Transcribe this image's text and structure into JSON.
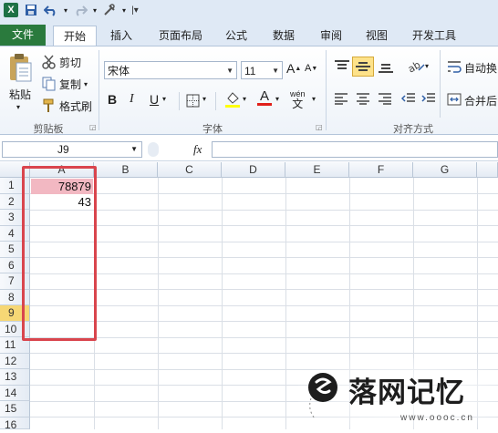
{
  "file_tab": "文件",
  "tabs": [
    "开始",
    "插入",
    "页面布局",
    "公式",
    "数据",
    "审阅",
    "视图",
    "开发工具"
  ],
  "clipboard": {
    "paste": "粘贴",
    "cut": "剪切",
    "copy": "复制",
    "format_painter": "格式刷",
    "group_label": "剪贴板"
  },
  "font": {
    "name": "宋体",
    "size": "11",
    "group_label": "字体",
    "bold": "B",
    "italic": "I",
    "underline": "U",
    "font_color_letter": "A",
    "phonetic": "wén"
  },
  "alignment": {
    "wrap_text": "自动换",
    "merge_center": "合并后",
    "group_label": "对齐方式"
  },
  "formula_bar": {
    "name_box": "J9",
    "fx": "fx",
    "formula": ""
  },
  "columns": [
    "A",
    "B",
    "C",
    "D",
    "E",
    "F",
    "G"
  ],
  "rows": [
    "1",
    "2",
    "3",
    "4",
    "5",
    "6",
    "7",
    "8",
    "9",
    "10",
    "11",
    "12",
    "13",
    "14",
    "15",
    "16"
  ],
  "cells": {
    "A1": "78879",
    "A2": "43"
  },
  "active_cell": "J9",
  "accent_colors": {
    "file_tab": "#2a7a3d",
    "highlight_cell": "#f2b8c2",
    "annotation_box": "#d9454d",
    "active_row_header": "#f6d775"
  },
  "watermark": {
    "brand": "落网记忆",
    "site": "www.oooc.cn"
  }
}
